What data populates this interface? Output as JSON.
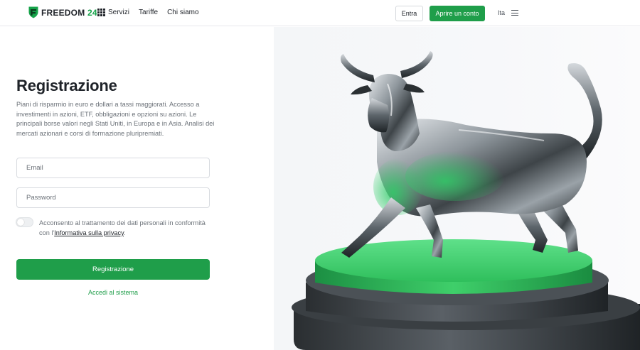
{
  "header": {
    "brand_word": "FREEDOM",
    "brand_number": "24",
    "nav": [
      "Servizi",
      "Tariffe",
      "Chi siamo"
    ],
    "login_label": "Entra",
    "open_account_label": "Aprire un conto",
    "language": "Ita",
    "icons": {
      "logo": "shield-logo-icon",
      "services": "grid-icon",
      "menu": "hamburger-menu-icon"
    }
  },
  "form": {
    "title": "Registrazione",
    "description": "Piani di risparmio in euro e dollari a tassi maggiorati. Accesso a investimenti in azioni, ETF, obbligazioni e opzioni su azioni. Le principali borse valori negli Stati Uniti, in Europa e in Asia. Analisi dei mercati azionari e corsi di formazione pluripremiati.",
    "email": {
      "placeholder": "Email",
      "value": ""
    },
    "password": {
      "placeholder": "Password",
      "value": ""
    },
    "consent_text": "Acconsento al trattamento dei dati personali in conformità con l'",
    "consent_link": "Informativa sulla privacy",
    "consent_end": ".",
    "consent_checked": false,
    "submit_label": "Registrazione",
    "login_link": "Accedi al sistema"
  },
  "hero": {
    "image": "silver-bull-statue-on-green-pedestal"
  },
  "colors": {
    "accent": "#1f9e4a",
    "brand_green": "#16a34a",
    "text": "#1f2329",
    "muted": "#6b7178"
  }
}
